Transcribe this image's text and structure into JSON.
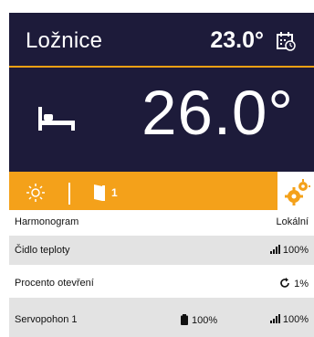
{
  "room": {
    "title": "Ložnice",
    "current_temp": "23.0°",
    "target_temp": "26.0°"
  },
  "status": {
    "open_count": "1"
  },
  "rows": [
    {
      "label": "Harmonogram",
      "value": "Lokální"
    },
    {
      "label": "Čidlo teploty",
      "value": "100%"
    },
    {
      "label": "Procento otevření",
      "value": "1%"
    },
    {
      "label": "Servopohon 1",
      "battery": "100%",
      "value": "100%"
    }
  ],
  "colors": {
    "panel_bg": "#1d1b3a",
    "accent": "#f4a11a",
    "row_alt": "#e3e3e3"
  },
  "icons": [
    "calendar-icon",
    "bed-icon",
    "sun-icon",
    "door-icon",
    "gear-icon",
    "signal-icon",
    "battery-icon",
    "refresh-icon"
  ]
}
